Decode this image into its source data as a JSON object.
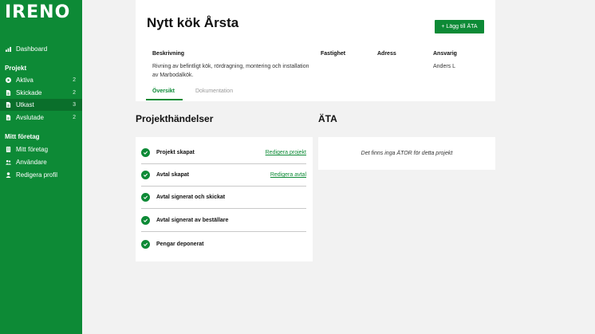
{
  "app": {
    "logo": "IRENO"
  },
  "sidebar": {
    "dashboard": {
      "label": "Dashboard"
    },
    "projekt_heading": "Projekt",
    "projekt_items": [
      {
        "label": "Aktiva",
        "count": "2",
        "icon": "play-icon"
      },
      {
        "label": "Skickade",
        "count": "2",
        "icon": "document-icon"
      },
      {
        "label": "Utkast",
        "count": "3",
        "icon": "document-icon"
      },
      {
        "label": "Avslutade",
        "count": "2",
        "icon": "document-icon"
      }
    ],
    "foretag_heading": "Mitt företag",
    "foretag_items": [
      {
        "label": "Mitt företag",
        "icon": "building-icon"
      },
      {
        "label": "Användare",
        "icon": "users-icon"
      },
      {
        "label": "Redigera profil",
        "icon": "user-icon"
      }
    ],
    "active_item": "Utkast"
  },
  "header": {
    "title": "Nytt kök Årsta",
    "add_button": "+ Lägg till ÄTA",
    "columns": {
      "beskrivning": {
        "label": "Beskrivning",
        "value": "Rivning av befintligt kök, rördragning, montering och installation av Marbodalkök."
      },
      "fastighet": {
        "label": "Fastighet",
        "value": ""
      },
      "adress": {
        "label": "Adress",
        "value": ""
      },
      "ansvarig": {
        "label": "Ansvarig",
        "value": "Anders L"
      }
    },
    "tabs": [
      {
        "label": "Översikt",
        "active": true
      },
      {
        "label": "Dokumentation",
        "active": false
      }
    ]
  },
  "events": {
    "title": "Projekthändelser",
    "items": [
      {
        "label": "Projekt skapat",
        "link": "Redigera projekt"
      },
      {
        "label": "Avtal skapat",
        "link": "Redigera avtal"
      },
      {
        "label": "Avtal signerat och skickat",
        "link": ""
      },
      {
        "label": "Avtal signerat av beställare",
        "link": ""
      },
      {
        "label": "Pengar deponerat",
        "link": ""
      }
    ]
  },
  "ata": {
    "title": "ÄTA",
    "empty_text": "Det finns inga ÄTOR för detta projekt"
  },
  "colors": {
    "brand": "#0d8a36",
    "active_nav": "#0a6f2b",
    "background": "#f2f2f2"
  }
}
